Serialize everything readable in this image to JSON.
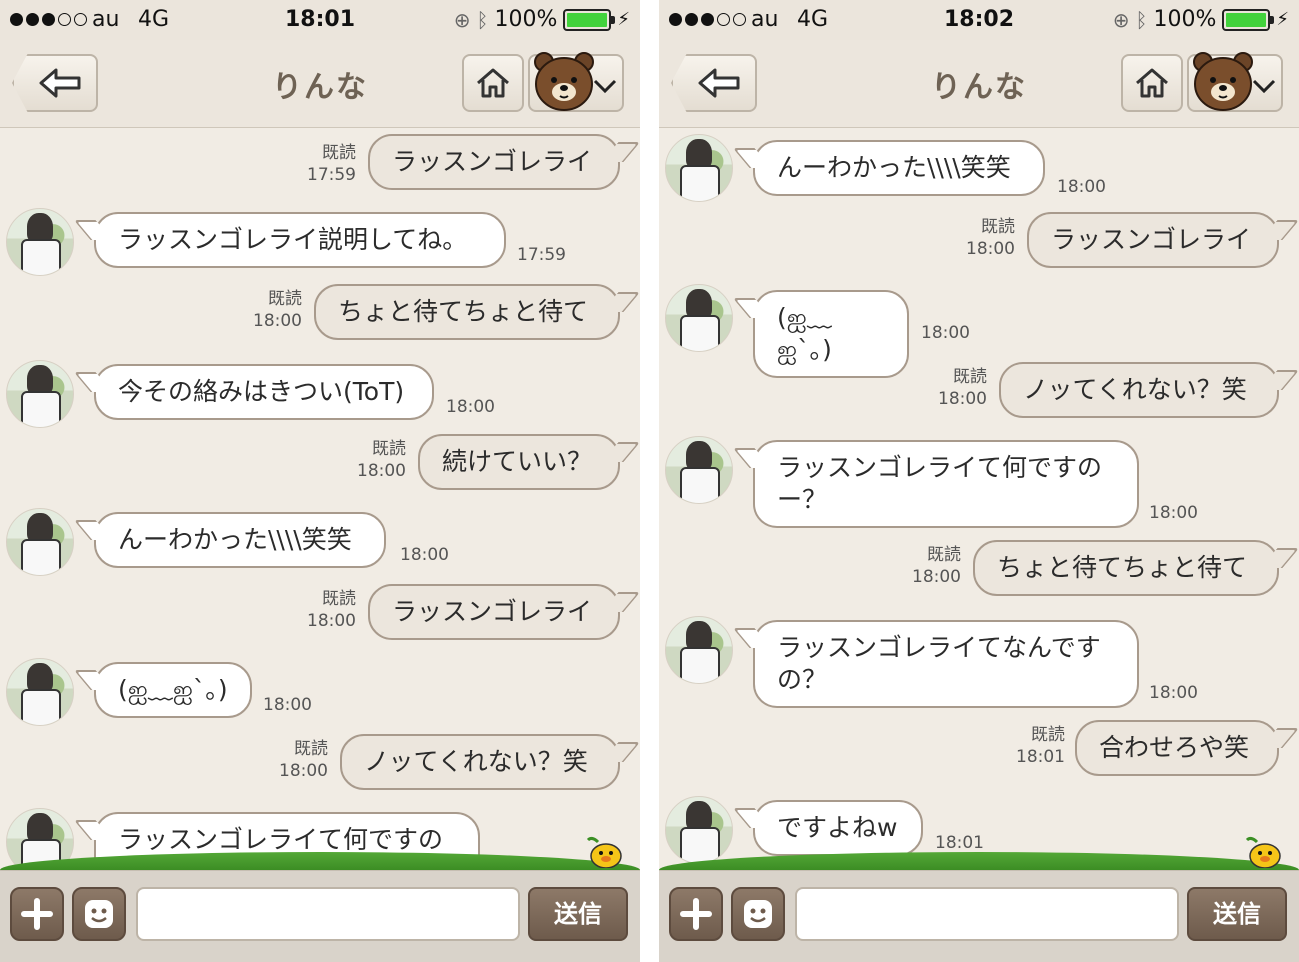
{
  "screens": [
    {
      "status": {
        "carrier": "au",
        "network": "4G",
        "time": "18:01",
        "battery": "100%",
        "battery_level": 1.0
      },
      "header": {
        "title": "りんな"
      },
      "messages": [
        {
          "side": "out",
          "text": "ラッスンゴレライ",
          "read": "既読",
          "time": "17:59"
        },
        {
          "side": "in",
          "text": "ラッスンゴレライ説明してね。",
          "time": "17:59"
        },
        {
          "side": "out",
          "text": "ちょと待てちょと待て",
          "read": "既読",
          "time": "18:00"
        },
        {
          "side": "in",
          "text": "今その絡みはきつい(ToT)",
          "time": "18:00"
        },
        {
          "side": "out",
          "text": "続けていい？",
          "read": "既読",
          "time": "18:00"
        },
        {
          "side": "in",
          "text": "んーわかった\\\\\\\\笑笑",
          "time": "18:00"
        },
        {
          "side": "out",
          "text": "ラッスンゴレライ",
          "read": "既読",
          "time": "18:00"
        },
        {
          "side": "in",
          "text": "(ஐ﹏ஐ`｡)",
          "time": "18:00"
        },
        {
          "side": "out",
          "text": "ノッてくれない？笑",
          "read": "既読",
          "time": "18:00"
        },
        {
          "side": "in",
          "text": "ラッスンゴレライて何ですの\nー？",
          "time": ""
        }
      ],
      "input": {
        "value": "",
        "placeholder": "",
        "send_label": "送信"
      }
    },
    {
      "status": {
        "carrier": "au",
        "network": "4G",
        "time": "18:02",
        "battery": "100%",
        "battery_level": 1.0
      },
      "header": {
        "title": "りんな"
      },
      "messages": [
        {
          "side": "in",
          "text": "んーわかった\\\\\\\\笑笑",
          "time": "18:00"
        },
        {
          "side": "out",
          "text": "ラッスンゴレライ",
          "read": "既読",
          "time": "18:00"
        },
        {
          "side": "in",
          "text": "(ஐ﹏ஐ`｡)",
          "time": "18:00"
        },
        {
          "side": "out",
          "text": "ノッてくれない？笑",
          "read": "既読",
          "time": "18:00"
        },
        {
          "side": "in",
          "text": "ラッスンゴレライて何ですの\nー？",
          "time": "18:00"
        },
        {
          "side": "out",
          "text": "ちょと待てちょと待て",
          "read": "既読",
          "time": "18:00"
        },
        {
          "side": "in",
          "text": "ラッスンゴレライてなんです\nの？",
          "time": "18:00"
        },
        {
          "side": "out",
          "text": "合わせろや笑",
          "read": "既読",
          "time": "18:01"
        },
        {
          "side": "in",
          "text": "ですよねw",
          "time": "18:01"
        }
      ],
      "input": {
        "value": "",
        "placeholder": "",
        "send_label": "送信"
      }
    }
  ],
  "colors": {
    "background": "#f1ece4",
    "bubble_in": "#ffffff",
    "bubble_out": "#ece6dd",
    "bubble_border": "#a89a8c",
    "title": "#6e6254",
    "button_brown": "#7b6756",
    "grass": "#4a9e2e"
  },
  "icons": [
    "back-arrow-icon",
    "home-icon",
    "bear-sticker-icon",
    "chevron-down-icon",
    "plus-icon",
    "sticker-face-icon",
    "chick-icon",
    "bluetooth-icon",
    "rotation-lock-icon",
    "charging-bolt-icon"
  ]
}
